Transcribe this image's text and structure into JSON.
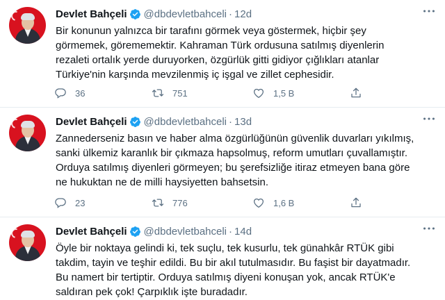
{
  "tweets": [
    {
      "author": "Devlet Bahçeli",
      "handle": "@dbdevletbahceli",
      "separator": "·",
      "time": "12d",
      "text": "Bir konunun yalnızca bir tarafını görmek veya göstermek, hiçbir şey\ngörmemek, görememektir. Kahraman Türk ordusuna satılmış diyenlerin\nrezaleti ortalık yerde duruyorken, özgürlük gitti gidiyor çığlıkları atanlar\nTürkiye'nin karşında mevzilenmiş iç işgal ve zillet cephesidir.",
      "replies": "36",
      "retweets": "751",
      "likes": "1,5 B"
    },
    {
      "author": "Devlet Bahçeli",
      "handle": "@dbdevletbahceli",
      "separator": "·",
      "time": "13d",
      "text": "Zannederseniz basın ve haber alma özgürlüğünün güvenlik duvarları yıkılmış,\nsanki ülkemiz karanlık bir çıkmaza hapsolmuş, reform umutları çuvallamıştır.\nOrduya satılmış diyenleri görmeyen; bu şerefsizliğe itiraz etmeyen bana göre\nne hukuktan ne de milli haysiyetten bahsetsin.",
      "replies": "23",
      "retweets": "776",
      "likes": "1,6 B"
    },
    {
      "author": "Devlet Bahçeli",
      "handle": "@dbdevletbahceli",
      "separator": "·",
      "time": "14d",
      "text": "Öyle bir noktaya gelindi ki, tek suçlu, tek kusurlu, tek günahkâr RTÜK gibi\ntakdim, tayin ve teşhir edildi. Bu bir akıl tutulmasıdır. Bu faşist bir dayatmadır.\nBu namert bir tertiptir. Orduya satılmış diyeni konuşan yok, ancak RTÜK'e\nsaldıran pek çok! Çarpıklık işte buradadır."
    }
  ],
  "colors": {
    "verified": "#1da1f2",
    "secondary_text": "#5b7083",
    "divider": "#e6ecf0",
    "avatar_bg": "#d8121f"
  },
  "icons": {
    "reply": "speech-bubble-icon",
    "retweet": "retweet-arrows-icon",
    "like": "heart-icon",
    "share": "share-upload-icon",
    "verified": "verified-badge-icon",
    "more": "more-dots-icon"
  }
}
